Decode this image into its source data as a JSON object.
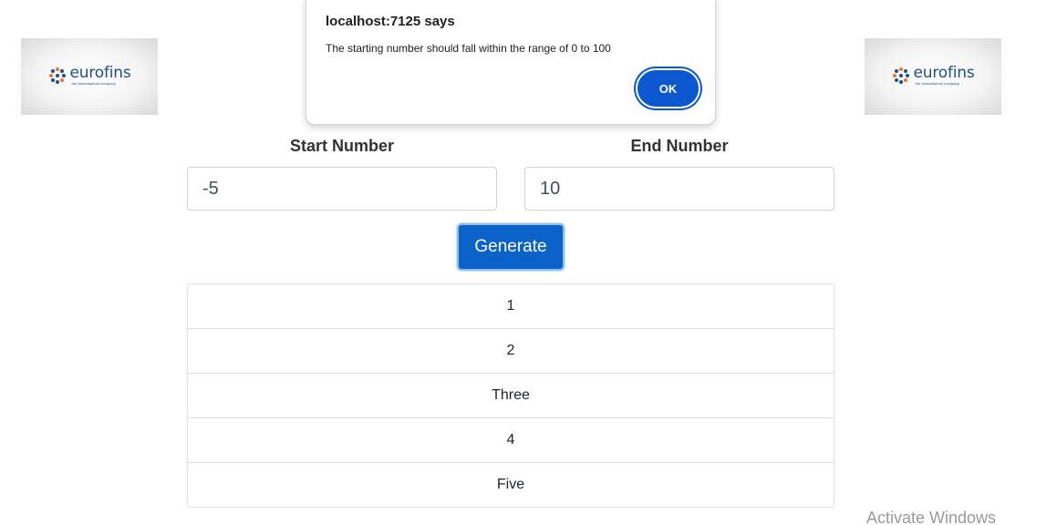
{
  "logos": {
    "brand": "eurofins",
    "tagline": "the bioanalytical company"
  },
  "form": {
    "start_label": "Start Number",
    "end_label": "End Number",
    "start_value": "-5",
    "end_value": "10",
    "generate_label": "Generate"
  },
  "results": [
    "1",
    "2",
    "Three",
    "4",
    "Five"
  ],
  "dialog": {
    "title": "localhost:7125 says",
    "message": "The starting number should fall within the range of 0 to 100",
    "ok_label": "OK"
  },
  "watermark": "Activate Windows",
  "colors": {
    "primary": "#0b62c9",
    "dialog_ok": "#0b57d0",
    "brand_blue": "#1f4e8c"
  }
}
